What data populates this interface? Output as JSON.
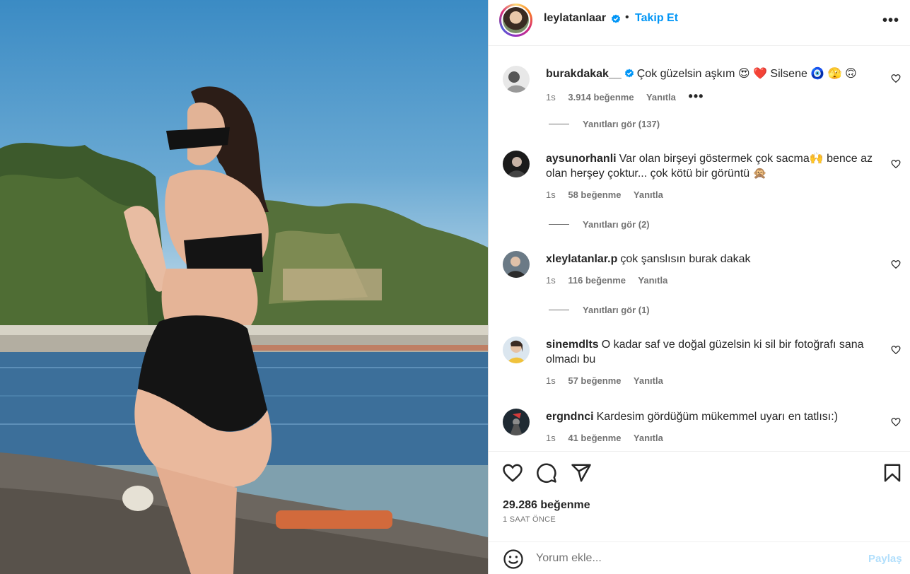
{
  "post": {
    "username": "leylatanlaar",
    "follow_label": "Takip Et",
    "separator": "•",
    "more_label": "•••"
  },
  "comments": [
    {
      "user": "burakdakak__",
      "verified": true,
      "text": "Çok güzelsin aşkım 😍 ❤️ Silsene 🧿 🫣 🙃",
      "time": "1s",
      "likes": "3.914 beğenme",
      "reply": "Yanıtla",
      "more": "•••",
      "view_replies": "Yanıtları gör (137)"
    },
    {
      "user": "aysunorhanli",
      "text": "Var olan birşeyi göstermek çok sacma🙌 bence az olan herşey çoktur... çok kötü bir görüntü 🙊",
      "time": "1s",
      "likes": "58 beğenme",
      "reply": "Yanıtla",
      "view_replies": "Yanıtları gör (2)"
    },
    {
      "user": "xleylatanlar.p",
      "text": "çok şanslısın burak dakak",
      "time": "1s",
      "likes": "116 beğenme",
      "reply": "Yanıtla",
      "view_replies": "Yanıtları gör (1)"
    },
    {
      "user": "sinemdlts",
      "text": "O kadar saf ve doğal güzelsin ki sil bir fotoğrafı sana olmadı bu",
      "time": "1s",
      "likes": "57 beğenme",
      "reply": "Yanıtla"
    },
    {
      "user": "ergndnci",
      "text": "Kardesim gördüğüm mükemmel uyarı en tatlısı:)",
      "time": "1s",
      "likes": "41 beğenme",
      "reply": "Yanıtla"
    }
  ],
  "stats": {
    "likes": "29.286 beğenme",
    "posted": "1 SAAT ÖNCE"
  },
  "composer": {
    "placeholder": "Yorum ekle...",
    "share_label": "Paylaş"
  },
  "icons": {
    "like": "heart-icon",
    "comment": "comment-icon",
    "share": "send-icon",
    "save": "bookmark-icon",
    "emoji": "emoji-icon",
    "verified": "verified-badge-icon"
  },
  "colors": {
    "accent": "#0095f6",
    "share_disabled": "#b2dffc",
    "secondary_text": "#737373",
    "verified": "#0095f6"
  }
}
